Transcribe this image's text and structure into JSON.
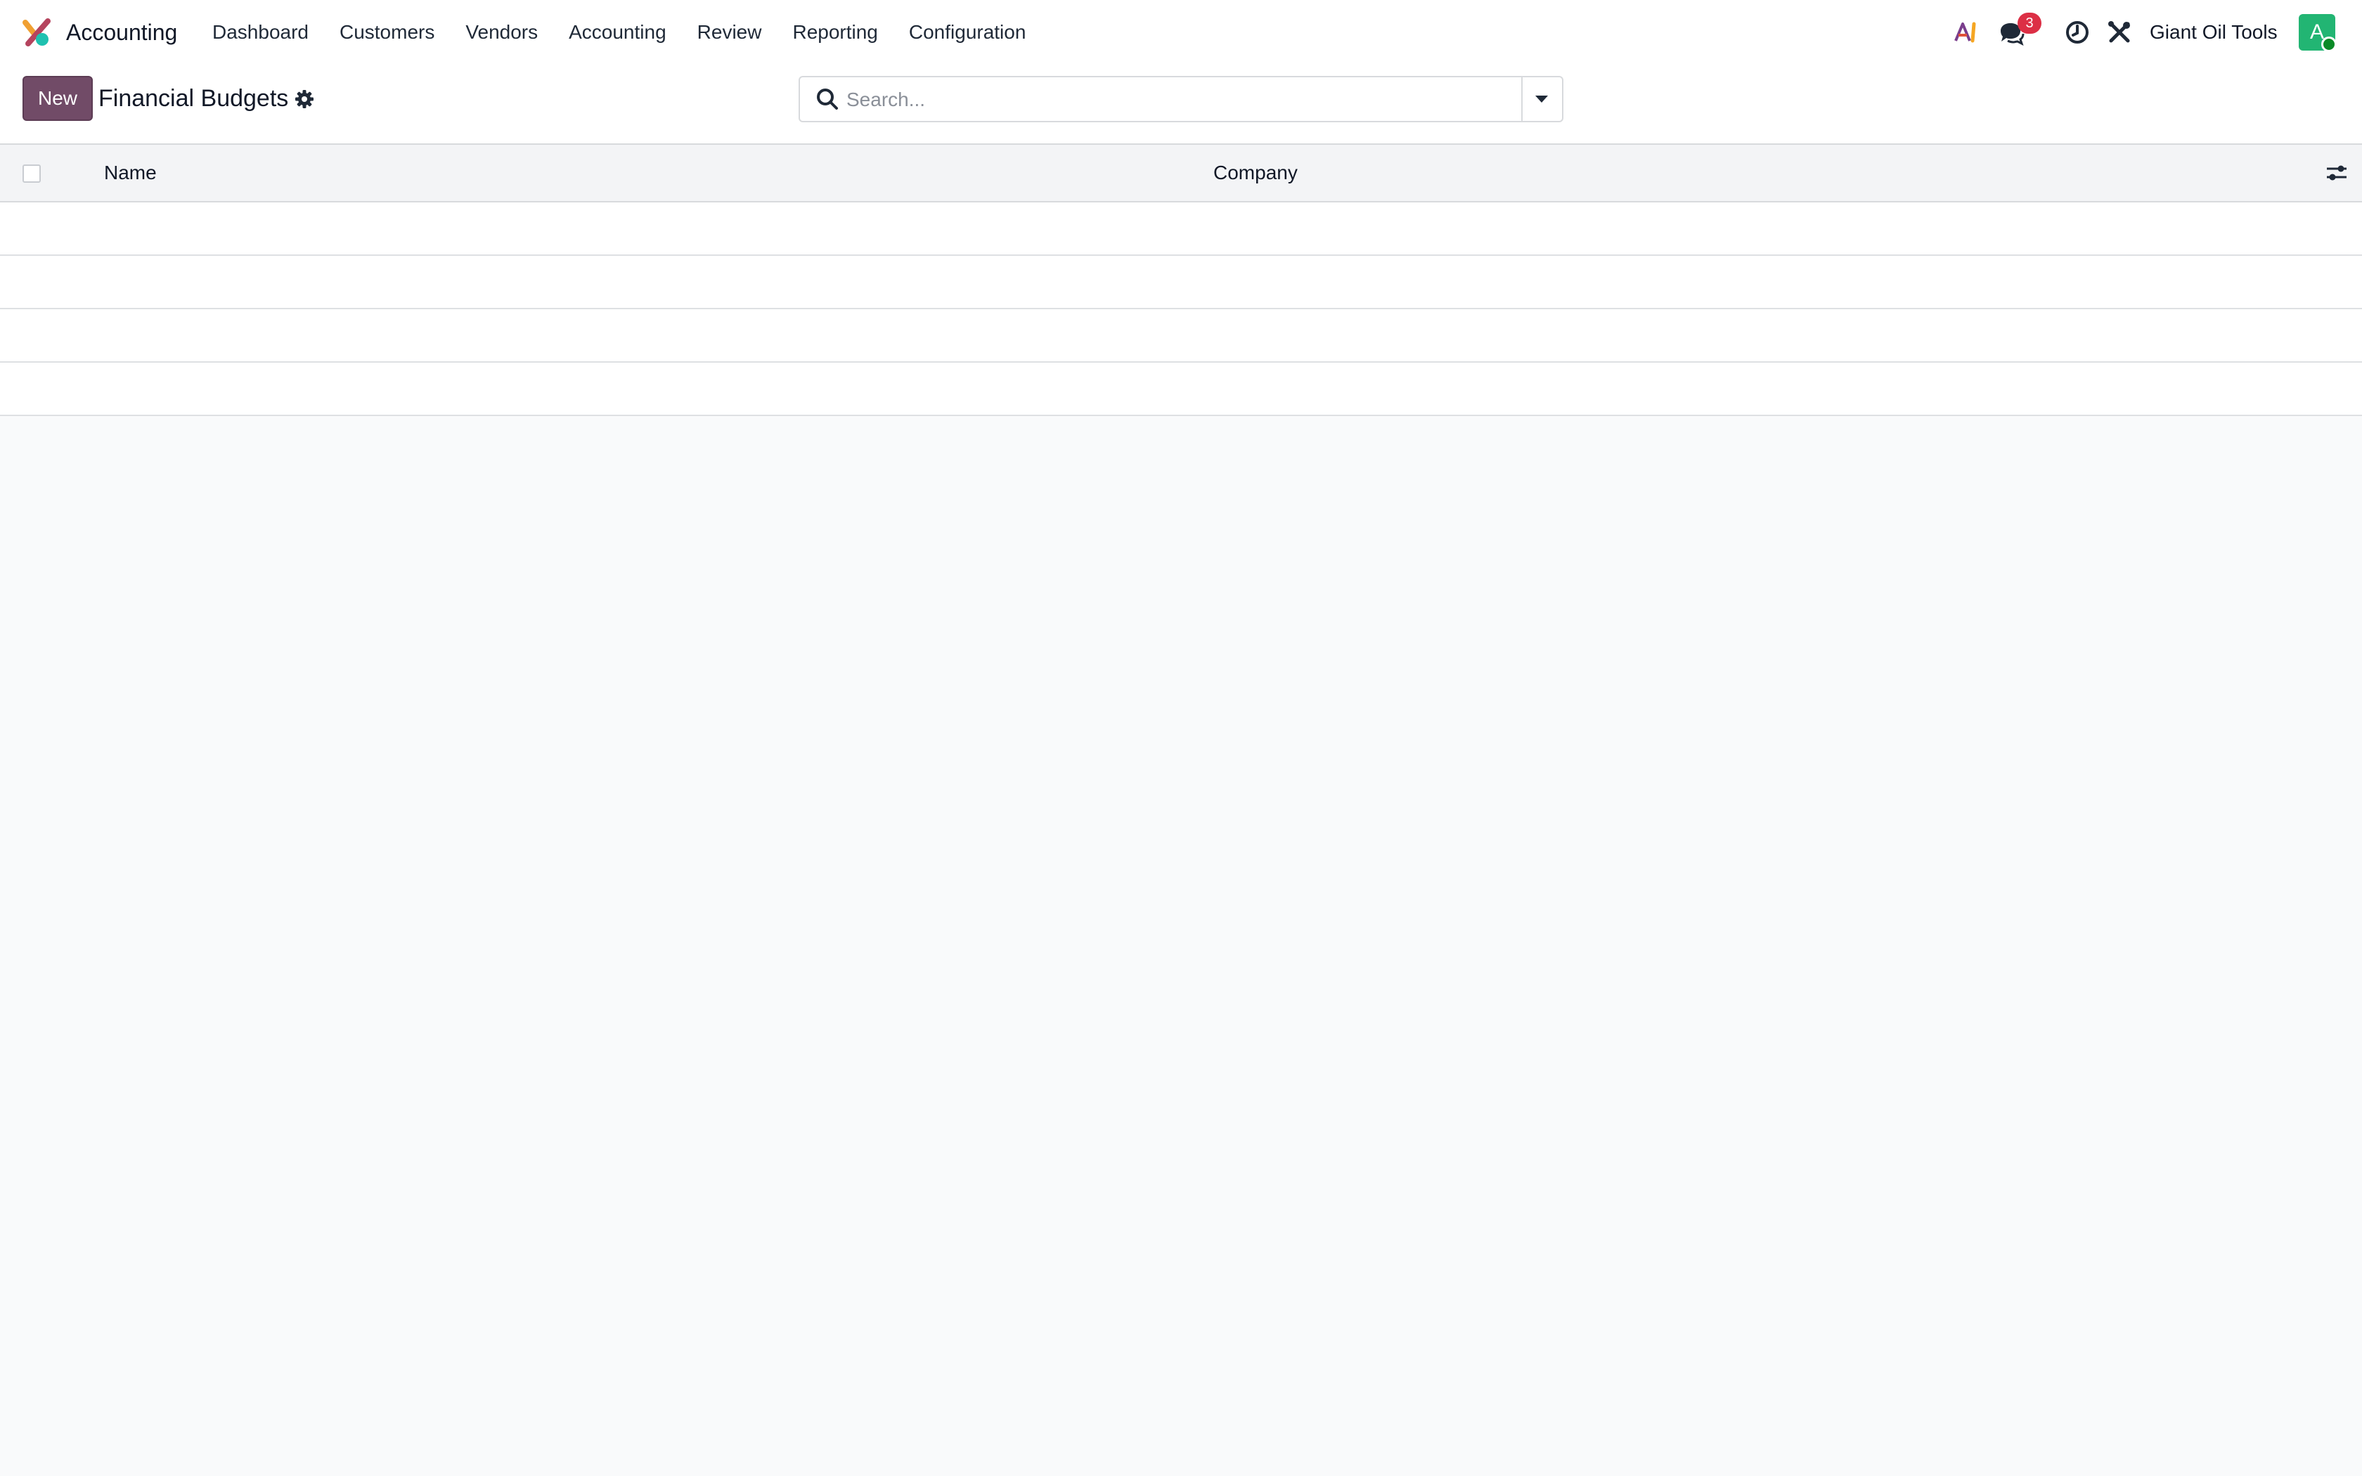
{
  "navbar": {
    "app_name": "Accounting",
    "menu": [
      {
        "label": "Dashboard"
      },
      {
        "label": "Customers"
      },
      {
        "label": "Vendors"
      },
      {
        "label": "Accounting"
      },
      {
        "label": "Review"
      },
      {
        "label": "Reporting"
      },
      {
        "label": "Configuration"
      }
    ],
    "systray": {
      "icons": [
        "ai-icon",
        "chat-icon",
        "clock-icon",
        "tools-icon"
      ],
      "message_count": "3",
      "company": "Giant Oil Tools",
      "avatar_initial": "A"
    }
  },
  "control_panel": {
    "new_label": "New",
    "title": "Financial Budgets",
    "search": {
      "value": "",
      "placeholder": "Search..."
    }
  },
  "list": {
    "columns": [
      {
        "label": "Name"
      },
      {
        "label": "Company"
      }
    ],
    "rows": [
      {
        "name": "",
        "company": ""
      },
      {
        "name": "",
        "company": ""
      },
      {
        "name": "",
        "company": ""
      },
      {
        "name": "",
        "company": ""
      }
    ]
  },
  "colors": {
    "primary": "#714b67",
    "badge": "#dc2f45",
    "avatar": "#22b573",
    "presence": "#0a8a26"
  }
}
